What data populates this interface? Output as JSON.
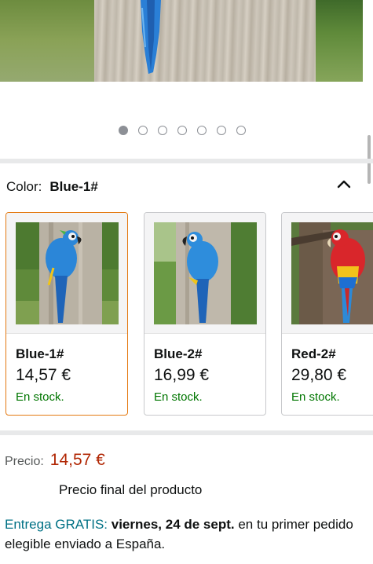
{
  "carousel": {
    "total_images": 7,
    "active_index": 0
  },
  "color_selector": {
    "label": "Color:",
    "selected_value": "Blue-1#"
  },
  "variants": [
    {
      "name": "Blue-1#",
      "price": "14,57 €",
      "stock": "En stock.",
      "selected": true
    },
    {
      "name": "Blue-2#",
      "price": "16,99 €",
      "stock": "En stock.",
      "selected": false
    },
    {
      "name": "Red-2#",
      "price": "29,80 €",
      "stock": "En stock.",
      "selected": false
    }
  ],
  "price": {
    "label": "Precio:",
    "value": "14,57 €",
    "note": "Precio final del producto"
  },
  "delivery": {
    "free_label": "Entrega GRATIS:",
    "date": "viernes, 24 de sept.",
    "rest": " en tu primer pedido elegible enviado a España."
  },
  "colors": {
    "accent_price": "#b12704",
    "in_stock": "#007600",
    "link": "#007185",
    "selected_border": "#e47911"
  }
}
